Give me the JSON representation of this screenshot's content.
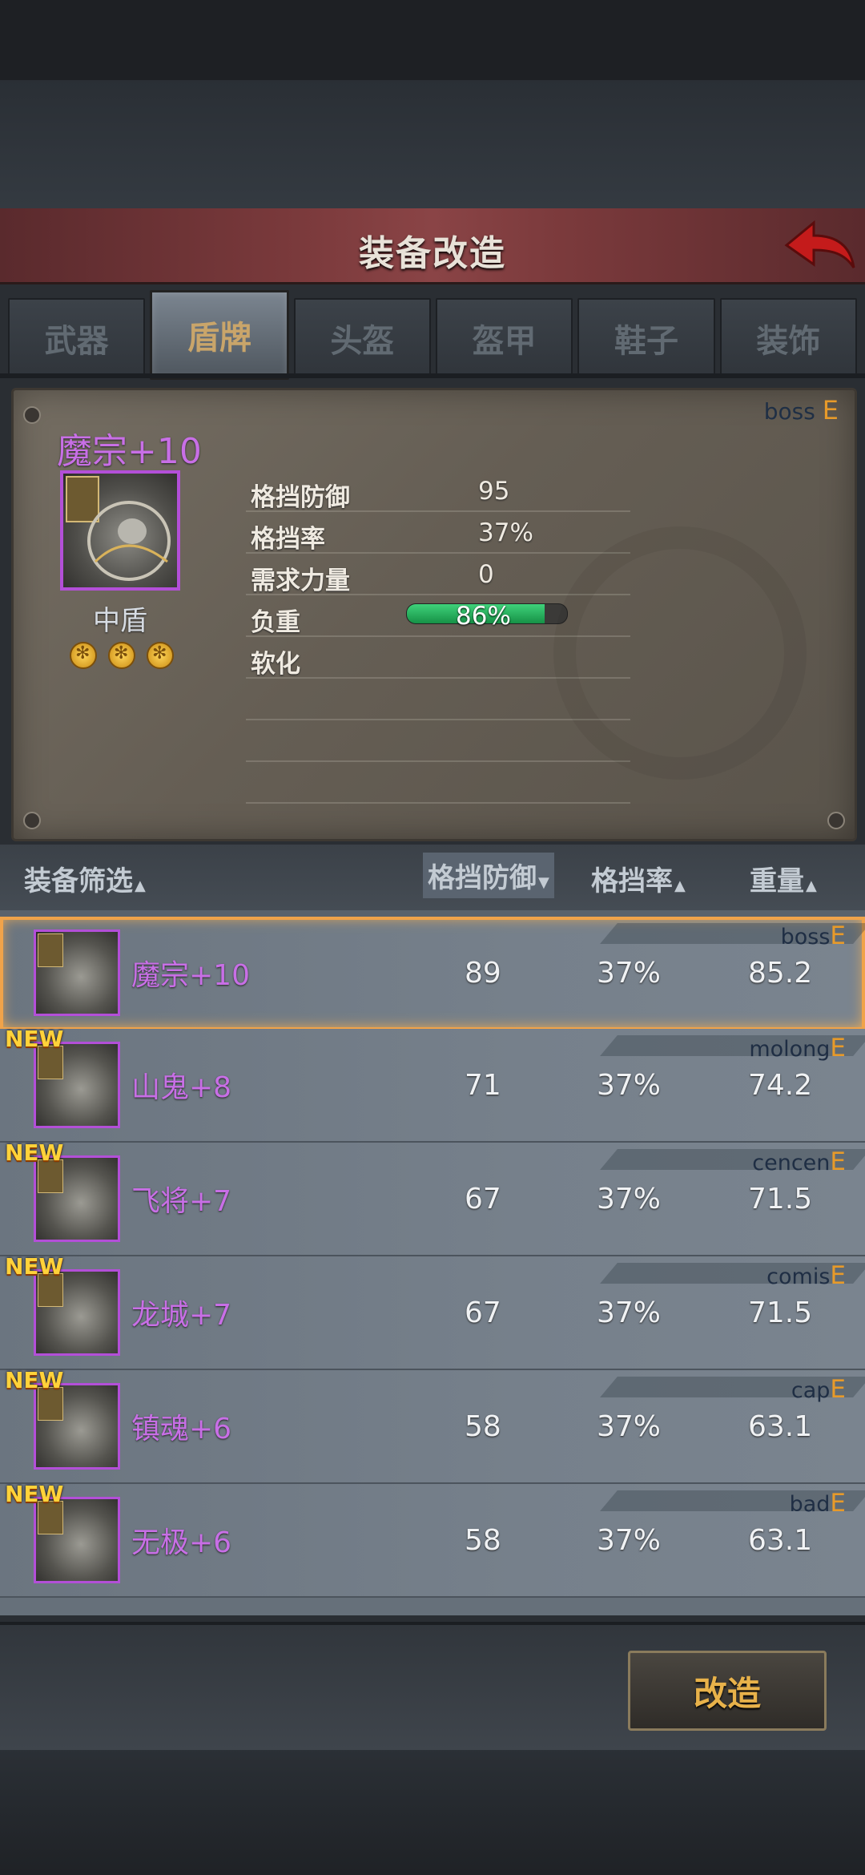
{
  "header": {
    "title": "装备改造"
  },
  "tabs": [
    {
      "label": "武器",
      "active": false
    },
    {
      "label": "盾牌",
      "active": true
    },
    {
      "label": "头盔",
      "active": false
    },
    {
      "label": "盔甲",
      "active": false
    },
    {
      "label": "鞋子",
      "active": false
    },
    {
      "label": "装饰",
      "active": false
    }
  ],
  "detail": {
    "source": "boss",
    "grade": "E",
    "name": "魔宗+10",
    "type": "中盾",
    "stars": 3,
    "stats": [
      {
        "label": "格挡防御",
        "value": "95"
      },
      {
        "label": "格挡率",
        "value": "37%"
      },
      {
        "label": "需求力量",
        "value": "0"
      },
      {
        "label": "负重",
        "value": "86%"
      },
      {
        "label": "软化",
        "value": ""
      }
    ],
    "weight_fraction": 0.86
  },
  "list_header": {
    "filter": "装备筛选",
    "col1": "格挡防御",
    "col2": "格挡率",
    "col3": "重量"
  },
  "items": [
    {
      "new": false,
      "name": "魔宗+10",
      "source": "boss",
      "grade": "E",
      "block_def": "89",
      "block_rate": "37%",
      "weight": "85.2",
      "selected": true
    },
    {
      "new": true,
      "new_label": "NEW",
      "name": "山鬼+8",
      "source": "molong",
      "grade": "E",
      "block_def": "71",
      "block_rate": "37%",
      "weight": "74.2"
    },
    {
      "new": true,
      "new_label": "NEW",
      "name": "飞将+7",
      "source": "cencen",
      "grade": "E",
      "block_def": "67",
      "block_rate": "37%",
      "weight": "71.5"
    },
    {
      "new": true,
      "new_label": "NEW",
      "name": "龙城+7",
      "source": "comis",
      "grade": "E",
      "block_def": "67",
      "block_rate": "37%",
      "weight": "71.5"
    },
    {
      "new": true,
      "new_label": "NEW",
      "name": "镇魂+6",
      "source": "cap",
      "grade": "E",
      "block_def": "58",
      "block_rate": "37%",
      "weight": "63.1"
    },
    {
      "new": true,
      "new_label": "NEW",
      "name": "无极+6",
      "source": "bad",
      "grade": "E",
      "block_def": "58",
      "block_rate": "37%",
      "weight": "63.1"
    }
  ],
  "actions": {
    "remake": "改造"
  },
  "colors": {
    "accent": "#e8b24a",
    "epic": "#c86fe6",
    "grade": "#e79a2a",
    "new": "#ffd23a"
  }
}
